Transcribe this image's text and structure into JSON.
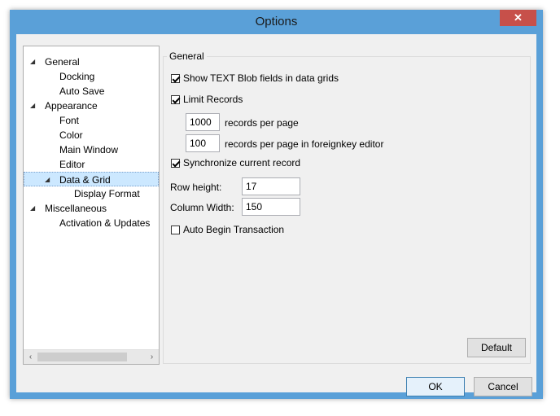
{
  "window": {
    "title": "Options",
    "close_glyph": "✕"
  },
  "tree": {
    "items": [
      {
        "label": "General",
        "expanded": true
      },
      {
        "label": "Docking"
      },
      {
        "label": "Auto Save"
      },
      {
        "label": "Appearance",
        "expanded": true
      },
      {
        "label": "Font"
      },
      {
        "label": "Color"
      },
      {
        "label": "Main Window"
      },
      {
        "label": "Editor"
      },
      {
        "label": "Data & Grid",
        "expanded": true,
        "selected": true
      },
      {
        "label": "Display Format"
      },
      {
        "label": "Miscellaneous",
        "expanded": true
      },
      {
        "label": "Activation & Updates"
      }
    ],
    "scroll_left": "‹",
    "scroll_right": "›"
  },
  "group": {
    "title": "General"
  },
  "options": {
    "show_text_blob": {
      "label": "Show TEXT Blob fields in data grids",
      "checked": true
    },
    "limit_records": {
      "label": "Limit Records",
      "checked": true
    },
    "records_per_page": {
      "value": "1000",
      "label": "records per page"
    },
    "records_per_page_fk": {
      "value": "100",
      "label": "records per page in foreignkey editor"
    },
    "sync_record": {
      "label": "Synchronize current record",
      "checked": true
    },
    "row_height": {
      "label": "Row height:",
      "value": "17"
    },
    "column_width": {
      "label": "Column Width:",
      "value": "150"
    },
    "auto_begin": {
      "label": "Auto Begin Transaction",
      "checked": false
    }
  },
  "buttons": {
    "default": "Default",
    "ok": "OK",
    "cancel": "Cancel"
  },
  "colors": {
    "titlebar": "#5aa0d8",
    "close": "#c7504a",
    "selection": "#cce8ff"
  }
}
